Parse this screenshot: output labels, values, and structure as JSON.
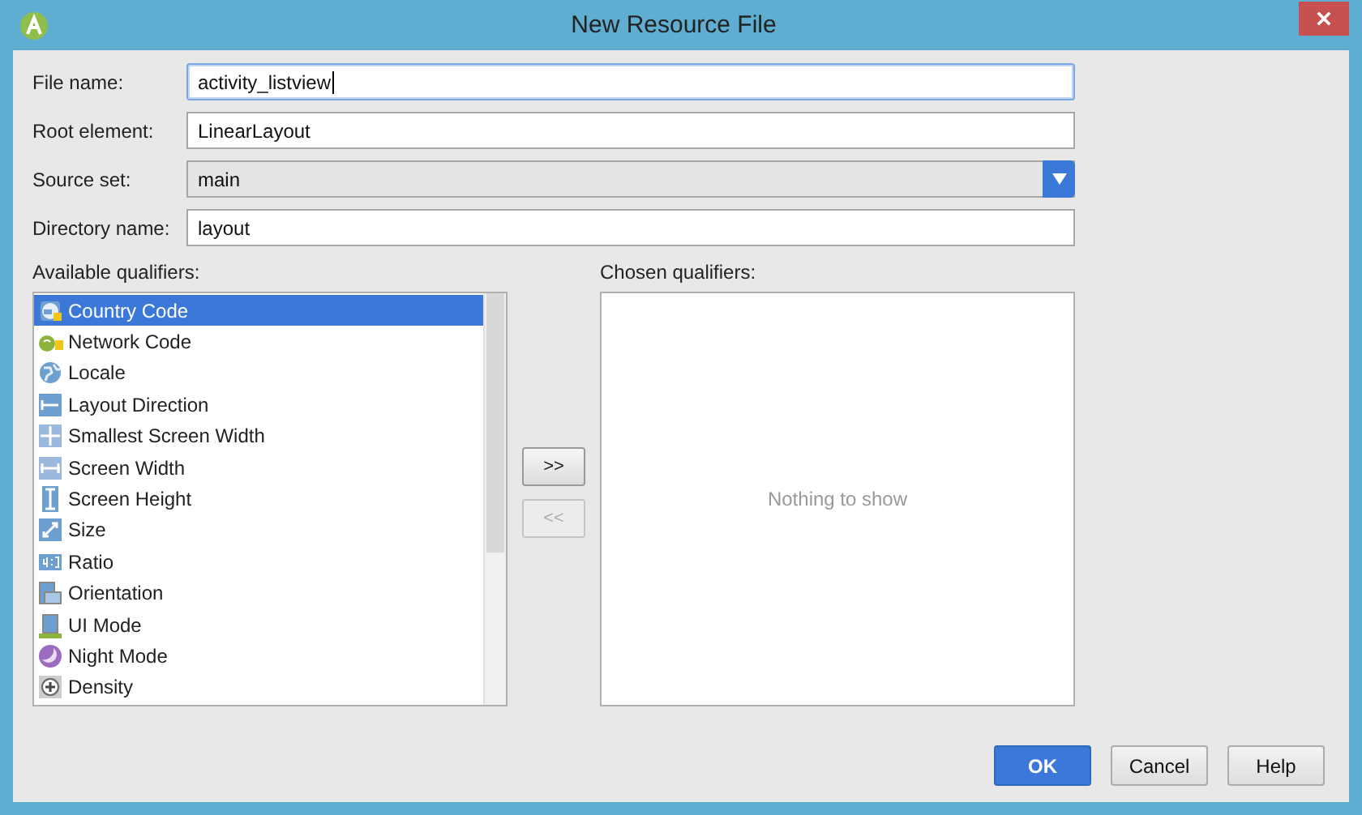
{
  "window": {
    "title": "New Resource File"
  },
  "form": [
    {
      "label": "File name:",
      "kind": "text",
      "value": "activity_listview",
      "focused": true
    },
    {
      "label": "Root element:",
      "kind": "text",
      "value": "LinearLayout",
      "focused": false
    },
    {
      "label": "Source set:",
      "kind": "dropdown",
      "value": "main",
      "focused": false
    },
    {
      "label": "Directory name:",
      "kind": "text",
      "value": "layout",
      "focused": false
    }
  ],
  "available": {
    "label": "Available qualifiers:",
    "items": [
      {
        "text": "Country Code",
        "kind": "country",
        "selected": true
      },
      {
        "text": "Network Code",
        "kind": "network",
        "selected": false
      },
      {
        "text": "Locale",
        "kind": "globe",
        "selected": false
      },
      {
        "text": "Layout Direction",
        "kind": "direction",
        "selected": false
      },
      {
        "text": "Smallest Screen Width",
        "kind": "cross",
        "selected": false
      },
      {
        "text": "Screen Width",
        "kind": "hwidth",
        "selected": false
      },
      {
        "text": "Screen Height",
        "kind": "vheight",
        "selected": false
      },
      {
        "text": "Size",
        "kind": "diagonal",
        "selected": false
      },
      {
        "text": "Ratio",
        "kind": "ratio",
        "selected": false
      },
      {
        "text": "Orientation",
        "kind": "orientation",
        "selected": false
      },
      {
        "text": "UI Mode",
        "kind": "uimode",
        "selected": false
      },
      {
        "text": "Night Mode",
        "kind": "moon",
        "selected": false
      },
      {
        "text": "Density",
        "kind": "density",
        "selected": false
      }
    ]
  },
  "move_buttons": [
    {
      "label": ">>",
      "disabled": false
    },
    {
      "label": "<<",
      "disabled": true
    }
  ],
  "chosen": {
    "label": "Chosen qualifiers:",
    "empty_text": "Nothing to show"
  },
  "buttons": [
    {
      "label": "OK",
      "kind": "primary"
    },
    {
      "label": "Cancel",
      "kind": "normal"
    },
    {
      "label": "Help",
      "kind": "normal"
    }
  ]
}
